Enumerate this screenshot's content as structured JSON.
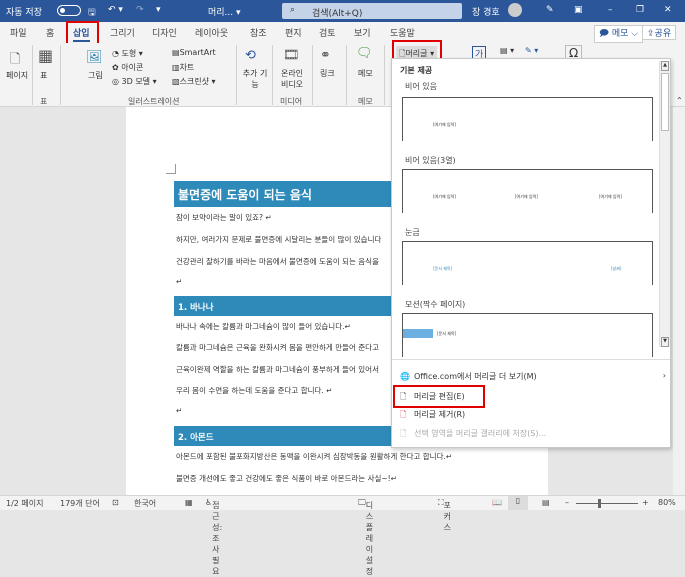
{
  "titlebar": {
    "autosave": "자동 저장",
    "toggle": "끔",
    "doc_title": "머리... ▾",
    "search_placeholder": "검색(Alt+Q)",
    "user": "장 경호"
  },
  "tabs": [
    "파일",
    "홈",
    "삽입",
    "그리기",
    "디자인",
    "레이아웃",
    "참조",
    "편지",
    "검토",
    "보기",
    "도움말"
  ],
  "active_tab": "삽입",
  "ribbon": {
    "memo": "메모",
    "share": "공유",
    "page": "페이지",
    "table": "표",
    "picture": "그림",
    "shapes": "도형",
    "icons": "아이콘",
    "model3d": "3D 모델",
    "smartart": "SmartArt",
    "chart": "차트",
    "screenshot": "스크린샷",
    "addins": "추가 기능",
    "online_video": "온라인 비디오",
    "link": "링크",
    "comment": "메모",
    "header": "머리글",
    "groups": {
      "table": "표",
      "illustrations": "일러스트레이션",
      "media": "미디어",
      "comments": "메모"
    }
  },
  "dropdown": {
    "builtin": "기본 제공",
    "items": [
      {
        "name": "비어 있음",
        "ph": [
          "[여기에 입력]"
        ]
      },
      {
        "name": "비어 있음(3열)",
        "ph": [
          "[여기에 입력]",
          "[여기에 입력]",
          "[여기에 입력]"
        ]
      },
      {
        "name": "눈금",
        "ph": [
          "[문서 제목]",
          "[날짜]"
        ]
      },
      {
        "name": "모션(짝수 페이지)",
        "ph": [
          "[문서 제목]"
        ]
      }
    ],
    "more": "Office.com에서 머리글 더 보기(M)",
    "edit": "머리글 편집(E)",
    "remove": "머리글 제거(R)",
    "save": "선택 영역을 머리글 갤러리에 저장(S)..."
  },
  "document": {
    "title": "불면증에 도움이 되는 음식",
    "intro": [
      "잠이 보약이라는 말이 있죠? ↵",
      "하지만, 여러가지 문제로 불면증에 시달리는 분들이 많이 있습니다",
      "건강관리 잘하기를 바라는 마음에서 불면증에 도움이 되는 음식을"
    ],
    "h1": "1. 바나나",
    "s1": [
      "바나나 속에는 칼륨과 마그네슘이 많이 들어 있습니다.↵",
      "칼륨과 마그네슘은 근육을 완화시켜 몸을 편안하게 만들어 준다고",
      "근육이완제 역할을 하는 칼륨과 마그네슘이 풍부하게 들어 있어서",
      "우리 몸이 수면을 하는데 도움을 준다고 합니다. ↵"
    ],
    "h2": "2. 아몬드",
    "s2": [
      "아몬드에 포함된 불포화지방산은 동맥을 이완시켜 심장박동을 원활하게 한다고 합니다.↵",
      "불면증 개선에도 좋고 건강에도 좋은 식품이 바로 아몬드라는 사실~!↵"
    ],
    "para": "↵"
  },
  "status": {
    "page": "1/2 페이지",
    "words": "179개 단어",
    "lang": "한국어",
    "access": "접근성: 조사 필요",
    "display": "디스플레이 설정",
    "focus": "포커스",
    "zoom": "80%"
  }
}
